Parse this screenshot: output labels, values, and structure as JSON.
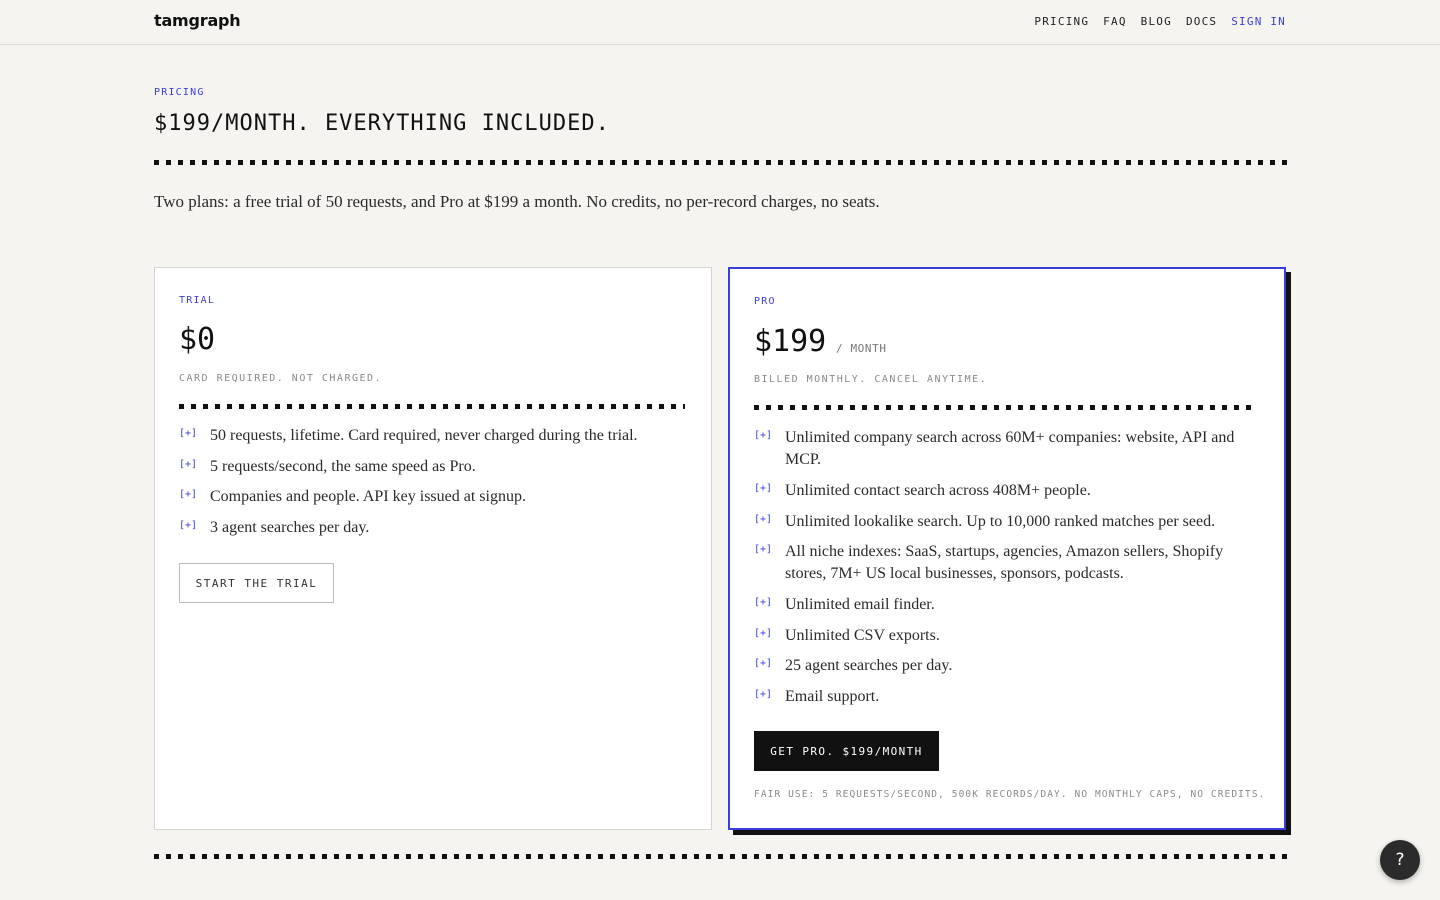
{
  "header": {
    "logo": "tamgraph",
    "nav": {
      "pricing": "PRICING",
      "faq": "FAQ",
      "blog": "BLOG",
      "docs": "DOCS",
      "sign_in": "SIGN IN"
    }
  },
  "hero": {
    "eyebrow": "PRICING",
    "title": "$199/MONTH. EVERYTHING INCLUDED.",
    "intro": "Two plans: a free trial of 50 requests, and Pro at $199 a month. No credits, no per-record charges, no seats."
  },
  "trial": {
    "label": "TRIAL",
    "price": "$0",
    "note": "CARD REQUIRED. NOT CHARGED.",
    "marker": "[+]",
    "features": [
      "50 requests, lifetime. Card required, never charged during the trial.",
      "5 requests/second, the same speed as Pro.",
      "Companies and people. API key issued at signup.",
      "3 agent searches per day."
    ],
    "cta": "START THE TRIAL"
  },
  "pro": {
    "label": "PRO",
    "price": "$199",
    "per": "/ MONTH",
    "note": "BILLED MONTHLY. CANCEL ANYTIME.",
    "marker": "[+]",
    "features": [
      "Unlimited company search across 60M+ companies: website, API and MCP.",
      "Unlimited contact search across 408M+ people.",
      "Unlimited lookalike search. Up to 10,000 ranked matches per seed.",
      "All niche indexes: SaaS, startups, agencies, Amazon sellers, Shopify stores, 7M+ US local businesses, sponsors, podcasts.",
      "Unlimited email finder.",
      "Unlimited CSV exports.",
      "25 agent searches per day.",
      "Email support."
    ],
    "cta": "GET PRO. $199/MONTH",
    "fair_use": "FAIR USE: 5 REQUESTS/SECOND, 500K RECORDS/DAY. NO MONTHLY CAPS, NO CREDITS."
  },
  "help": {
    "label": "?"
  },
  "colors": {
    "accent": "#3a3fd9",
    "background": "#f5f4f0",
    "ink": "#111111"
  }
}
